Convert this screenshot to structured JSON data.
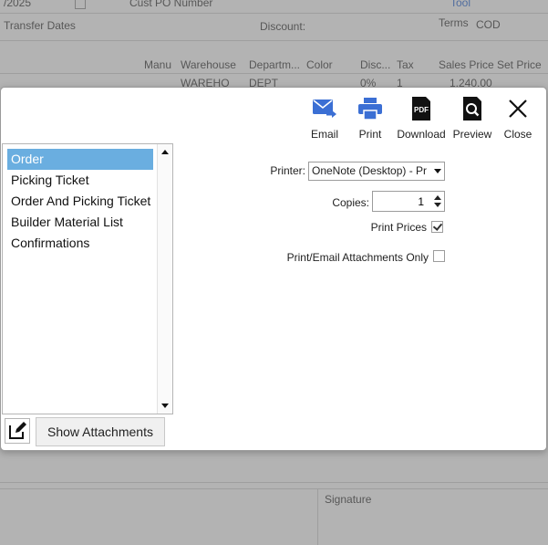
{
  "background": {
    "row1": {
      "c1": "/2025",
      "c2": "Cust PO Number",
      "c3": "Tool"
    },
    "transfer_dates": "Transfer Dates",
    "discount": "Discount:",
    "terms_label": "Terms",
    "terms_value": "COD",
    "columns": [
      "Manu",
      "Warehouse",
      "Departm...",
      "Color",
      "Disc...",
      "Tax",
      "Sales Price",
      "Set Price"
    ],
    "row_values": [
      "WAREHO",
      "DEPT",
      "0%",
      "1",
      "1,240.00"
    ],
    "signature": "Signature"
  },
  "toolbar": [
    {
      "name": "email-button",
      "icon": "email-icon",
      "label": "Email"
    },
    {
      "name": "print-button",
      "icon": "printer-icon",
      "label": "Print"
    },
    {
      "name": "download-button",
      "icon": "pdf-icon",
      "label": "Download"
    },
    {
      "name": "preview-button",
      "icon": "preview-icon",
      "label": "Preview"
    },
    {
      "name": "close-button",
      "icon": "close-icon",
      "label": "Close"
    }
  ],
  "reports": [
    "Order",
    "Picking Ticket",
    "Order And Picking Ticket",
    "Builder Material List",
    "Confirmations"
  ],
  "selected_report": "Order",
  "form": {
    "printer_label": "Printer:",
    "printer_value": "OneNote (Desktop) - Pr",
    "copies_label": "Copies:",
    "copies_value": "1",
    "print_prices_label": "Print Prices",
    "print_prices_checked": true,
    "attachments_only_label": "Print/Email Attachments Only",
    "attachments_only_checked": false
  },
  "show_attachments_label": "Show Attachments",
  "colors": {
    "accent": "#3b6fd4",
    "selection": "#6aaee0"
  }
}
